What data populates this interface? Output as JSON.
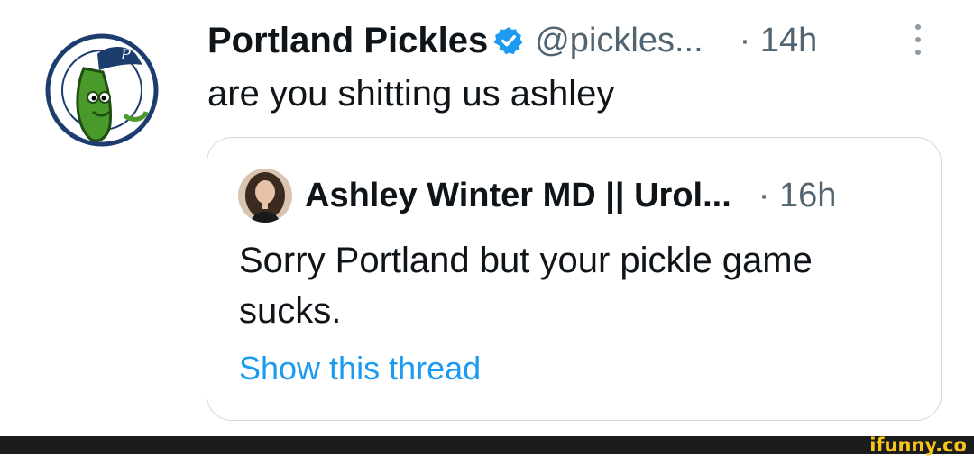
{
  "tweet": {
    "author_name": "Portland Pickles",
    "handle": "@pickles...",
    "time": "· 14h",
    "text": "are you shitting us ashley",
    "avatar_icon": "portland-pickles-logo"
  },
  "quoted_tweet": {
    "author_name": "Ashley Winter MD || Urol...",
    "time": "· 16h",
    "text": "Sorry Portland but your pickle game sucks.",
    "show_thread_label": "Show this thread"
  },
  "watermark": {
    "text": "ifunny.co"
  },
  "colors": {
    "text": "#0f1419",
    "secondary": "#536471",
    "link": "#1d9bf0",
    "border": "#cfd9de",
    "verified": "#1d9bf0",
    "watermark": "#f7c41a"
  }
}
